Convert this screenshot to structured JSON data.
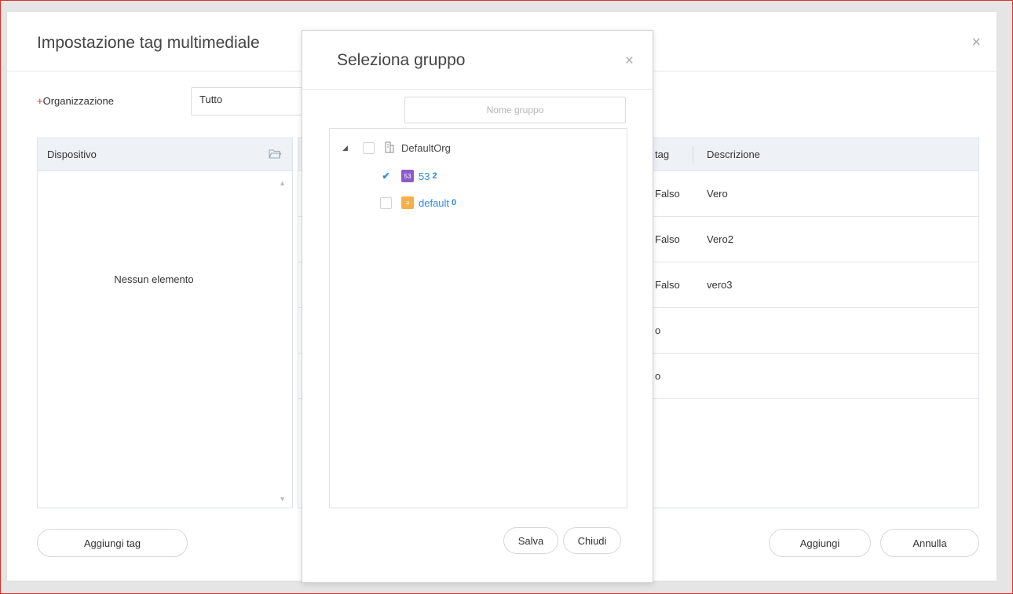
{
  "outer_dialog": {
    "title": "Impostazione tag multimediale",
    "close_glyph": "×",
    "organization": {
      "label": "Organizzazione",
      "required_marker": "+",
      "value": "Tutto"
    },
    "device_panel": {
      "header": "Dispositivo",
      "empty_text": "Nessun elemento",
      "scroll_up_glyph": "▲",
      "scroll_down_glyph": "▼"
    },
    "tag_table": {
      "columns": [
        "tag",
        "Descrizione"
      ],
      "rows": [
        {
          "tag": "Falso",
          "descrizione": "Vero"
        },
        {
          "tag": "Falso",
          "descrizione": "Vero2"
        },
        {
          "tag": "Falso",
          "descrizione": "vero3"
        },
        {
          "tag": "o",
          "descrizione": ""
        },
        {
          "tag": "o",
          "descrizione": ""
        }
      ]
    },
    "buttons": {
      "add_tag": "Aggiungi tag",
      "add": "Aggiungi",
      "cancel": "Annulla"
    }
  },
  "group_modal": {
    "title": "Seleziona gruppo",
    "close_glyph": "×",
    "search_placeholder": "Nome gruppo",
    "tree": {
      "root": {
        "label": "DefaultOrg",
        "expanded": true,
        "caret_glyph": "◢",
        "icon": "building-icon",
        "checked": false
      },
      "children": [
        {
          "label": "53",
          "count": "2",
          "badge_text": "53",
          "badge_color": "#8c5bc9",
          "icon": "group-badge-icon",
          "checked": true
        },
        {
          "label": "default",
          "count": "0",
          "badge_text": "≡",
          "badge_color": "#f5b04a",
          "icon": "group-badge-icon",
          "checked": false
        }
      ],
      "check_glyph": "✔"
    },
    "buttons": {
      "save": "Salva",
      "close": "Chiudi"
    }
  },
  "colors": {
    "accent_blue": "#2e8ae6",
    "required_red": "#e0302b",
    "header_bg": "#eef2f7"
  }
}
